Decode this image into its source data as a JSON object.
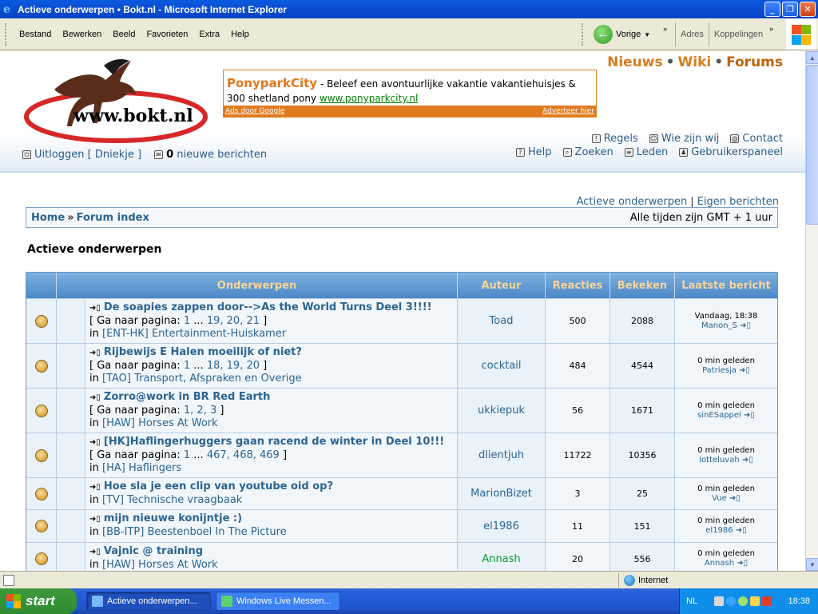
{
  "window": {
    "title": "Actieve onderwerpen • Bokt.nl - Microsoft Internet Explorer"
  },
  "menu": [
    "Bestand",
    "Bewerken",
    "Beeld",
    "Favorieten",
    "Extra",
    "Help"
  ],
  "toolbar": {
    "back_label": "Vorige",
    "address_label": "Adres",
    "links_label": "Koppelingen"
  },
  "site": {
    "logo_text": "www.bokt.nl",
    "toplinks": [
      "Nieuws",
      "Wiki",
      "Forums"
    ],
    "ad": {
      "title": "PonyparkCity",
      "text": "- Beleef een avontuurlijke vakantie vakantiehuisjes & 300 shetland pony",
      "link": "www.ponyparkcity.nl",
      "footer_left": "Ads door Google",
      "footer_right": "Adverteer hier"
    },
    "links_row1": [
      "Regels",
      "Wie zijn wij",
      "Contact"
    ],
    "links_row2": [
      "Help",
      "Zoeken",
      "Leden",
      "Gebruikerspaneel"
    ],
    "user": {
      "logout": "Uitloggen",
      "username": "Dniekje",
      "new_count": "0",
      "new_label": "nieuwe berichten"
    },
    "sublinks": [
      "Actieve onderwerpen",
      "Eigen berichten"
    ],
    "breadcrumb": [
      "Home",
      "Forum index"
    ],
    "timezone": "Alle tijden zijn GMT + 1 uur",
    "page_title": "Actieve onderwerpen"
  },
  "table": {
    "headers": [
      "Onderwerpen",
      "Auteur",
      "Reacties",
      "Bekeken",
      "Laatste bericht"
    ],
    "rows": [
      {
        "title": "De soapies zappen door-->As the World Turns Deel 3!!!!",
        "pages": [
          "1",
          "...",
          "19,",
          "20,",
          "21"
        ],
        "forum_code": "[ENT-HK]",
        "forum_name": "Entertainment-Huiskamer",
        "author": "Toad",
        "replies": "500",
        "views": "2088",
        "last_time": "Vandaag, 18:38",
        "last_user": "Manon_S"
      },
      {
        "title": "Rijbewijs E Halen moeilijk of niet?",
        "pages": [
          "1",
          "...",
          "18,",
          "19,",
          "20"
        ],
        "forum_code": "[TAO]",
        "forum_name": "Transport, Afspraken en Overige",
        "author": "cocktail",
        "replies": "484",
        "views": "4544",
        "last_time": "0 min geleden",
        "last_user": "Patriesja"
      },
      {
        "title": "Zorro@work in BR Red Earth",
        "pages": [
          "1,",
          "2,",
          "3"
        ],
        "forum_code": "[HAW]",
        "forum_name": "Horses At Work",
        "author": "ukkiepuk",
        "replies": "56",
        "views": "1671",
        "last_time": "0 min geleden",
        "last_user": "sinESappel"
      },
      {
        "title": "[HK]Haflingerhuggers gaan racend de winter in Deel 10!!!",
        "pages": [
          "1",
          "...",
          "467,",
          "468,",
          "469"
        ],
        "forum_code": "[HA]",
        "forum_name": "Haflingers",
        "author": "dlientjuh",
        "replies": "11722",
        "views": "10356",
        "last_time": "0 min geleden",
        "last_user": "lotteluvah"
      },
      {
        "title": "Hoe sla je een clip van youtube oid op?",
        "pages": [],
        "forum_code": "[TV]",
        "forum_name": "Technische vraagbaak",
        "author": "MarionBizet",
        "replies": "3",
        "views": "25",
        "last_time": "0 min geleden",
        "last_user": "Vue"
      },
      {
        "title": "mijn nieuwe konijntje :)",
        "pages": [],
        "forum_code": "[BB-ITP]",
        "forum_name": "Beestenboel In The Picture",
        "author": "el1986",
        "replies": "11",
        "views": "151",
        "last_time": "0 min geleden",
        "last_user": "el1986"
      },
      {
        "title": "Vajnic @ training",
        "pages": [],
        "forum_code": "[HAW]",
        "forum_name": "Horses At Work",
        "author": "Annash",
        "replies": "20",
        "views": "556",
        "last_time": "0 min geleden",
        "last_user": "Annash"
      }
    ],
    "goto_label": "Ga naar pagina:",
    "in_label": "in"
  },
  "status": {
    "zone": "Internet"
  },
  "taskbar": {
    "start": "start",
    "tasks": [
      "Actieve onderwerpen...",
      "Windows Live Messen..."
    ],
    "lang": "NL",
    "clock": "18:38"
  },
  "colors": {
    "accent": "#2c6490",
    "header_text": "#f6d49a",
    "toplinks": "#d97d1f"
  }
}
